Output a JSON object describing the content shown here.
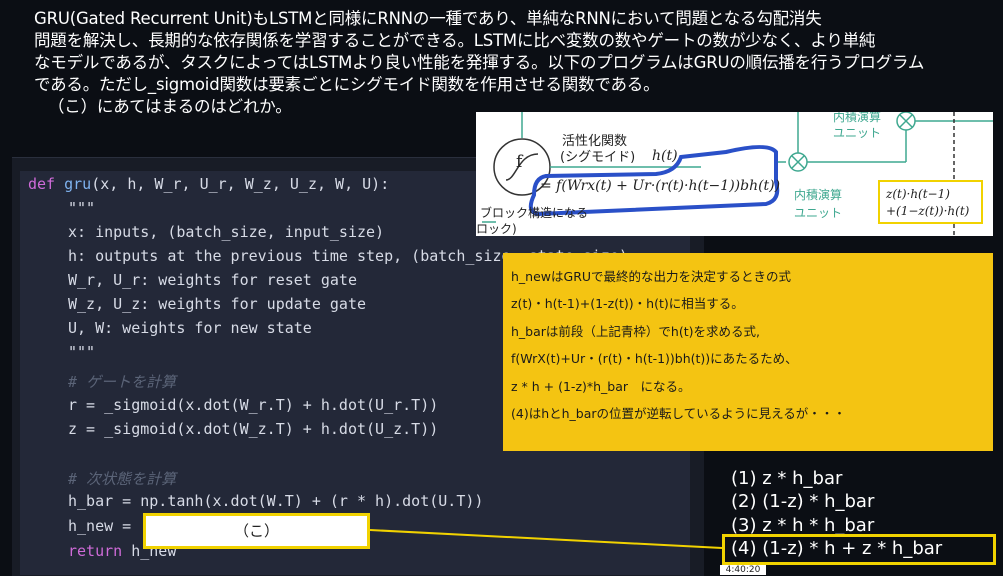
{
  "question": {
    "lines": [
      "GRU(Gated Recurrent Unit)もLSTMと同様にRNNの一種であり、単純なRNNにおいて問題となる勾配消失",
      "問題を解決し、長期的な依存関係を学習することができる。LSTMに比べ変数の数やゲートの数が少なく、より単純",
      "なモデルであるが、タスクによってはLSTMより良い性能を発揮する。以下のプログラムはGRUの順伝播を行うプログラム",
      "である。ただし_sigmoid関数は要素ごとにシグモイド関数を作用させる関数である。",
      "（こ）にあてはまるのはどれか。"
    ]
  },
  "diagram": {
    "activation_label": "活性化関数",
    "sigmoid_label": "(シグモイド)",
    "ht_label": "h(t)",
    "formula": "= f(Wrx(t) + Ur·(r(t)·h(t−1))bh(t))",
    "block_label": "ブロック構造になる",
    "block_label2": "ロック)",
    "inner_product_label": "内積演算",
    "unit_label": "ユニット",
    "top_label": "内積演算",
    "top_unit": "ユニット",
    "output_line1": "z(t)·h(t−1)",
    "output_line2": "+(1−z(t))·h(t)",
    "f_symbol": "f"
  },
  "code": {
    "line1_def": "def",
    "line1_fn": "gru",
    "line1_args": "(x, h, W_r, U_r, W_z, U_z, W, U):",
    "doc_open": "\"\"\"",
    "doc1": "x: inputs, (batch_size, input_size)",
    "doc2": "h: outputs at the previous time step, (batch_size, state_size)",
    "doc3": "W_r, U_r: weights for reset gate",
    "doc4": "W_z, U_z: weights for update gate",
    "doc5": "U, W: weights for new state",
    "doc_close": "\"\"\"",
    "comment_gate": "# ゲートを計算",
    "r_line": "r = _sigmoid(x.dot(W_r.T) + h.dot(U_r.T))",
    "z_line": "z = _sigmoid(x.dot(W_z.T) + h.dot(U_z.T))",
    "comment_state": "# 次状態を計算",
    "hbar_line": "h_bar = np.tanh(x.dot(W.T) + (r * h).dot(U.T))",
    "hnew_line": "h_new = ",
    "return_kw": "return",
    "return_val": " h_new",
    "blank_label": "（こ）"
  },
  "note": {
    "lines": [
      "h_newはGRUで最終的な出力を決定するときの式",
      "z(t)・h(t-1)+(1-z(t))・h(t)に相当する。",
      "h_barは前段（上記青枠）でh(t)を求める式,",
      "f(WrX(t)+Ur・(r(t)・h(t-1))bh(t))にあたるため、",
      "z * h + (1-z)*h_bar　になる。",
      "(4)はhとh_barの位置が逆転しているように見えるが・・・"
    ]
  },
  "choices": [
    "(1)  z * h_bar",
    "(2)  (1-z) * h_bar",
    "(3)  z * h * h_bar",
    "(4)  (1-z) * h + z * h_bar"
  ],
  "timestamp": "4:40:20"
}
